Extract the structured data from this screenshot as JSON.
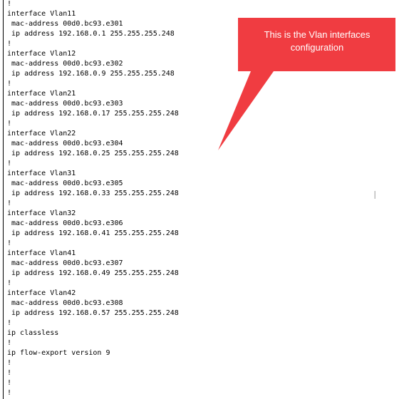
{
  "config_lines": [
    "!",
    "interface Vlan11",
    " mac-address 00d0.bc93.e301",
    " ip address 192.168.0.1 255.255.255.248",
    "!",
    "interface Vlan12",
    " mac-address 00d0.bc93.e302",
    " ip address 192.168.0.9 255.255.255.248",
    "!",
    "interface Vlan21",
    " mac-address 00d0.bc93.e303",
    " ip address 192.168.0.17 255.255.255.248",
    "!",
    "interface Vlan22",
    " mac-address 00d0.bc93.e304",
    " ip address 192.168.0.25 255.255.255.248",
    "!",
    "interface Vlan31",
    " mac-address 00d0.bc93.e305",
    " ip address 192.168.0.33 255.255.255.248",
    "!",
    "interface Vlan32",
    " mac-address 00d0.bc93.e306",
    " ip address 192.168.0.41 255.255.255.248",
    "!",
    "interface Vlan41",
    " mac-address 00d0.bc93.e307",
    " ip address 192.168.0.49 255.255.255.248",
    "!",
    "interface Vlan42",
    " mac-address 00d0.bc93.e308",
    " ip address 192.168.0.57 255.255.255.248",
    "!",
    "ip classless",
    "!",
    "ip flow-export version 9",
    "!",
    "!",
    "!",
    "!"
  ],
  "callout": {
    "text_line1": "This is the Vlan interfaces",
    "text_line2": "configuration",
    "fill_color": "#f03c41"
  },
  "cursor": {
    "icon": "text-cursor-icon",
    "glyph": "I"
  }
}
